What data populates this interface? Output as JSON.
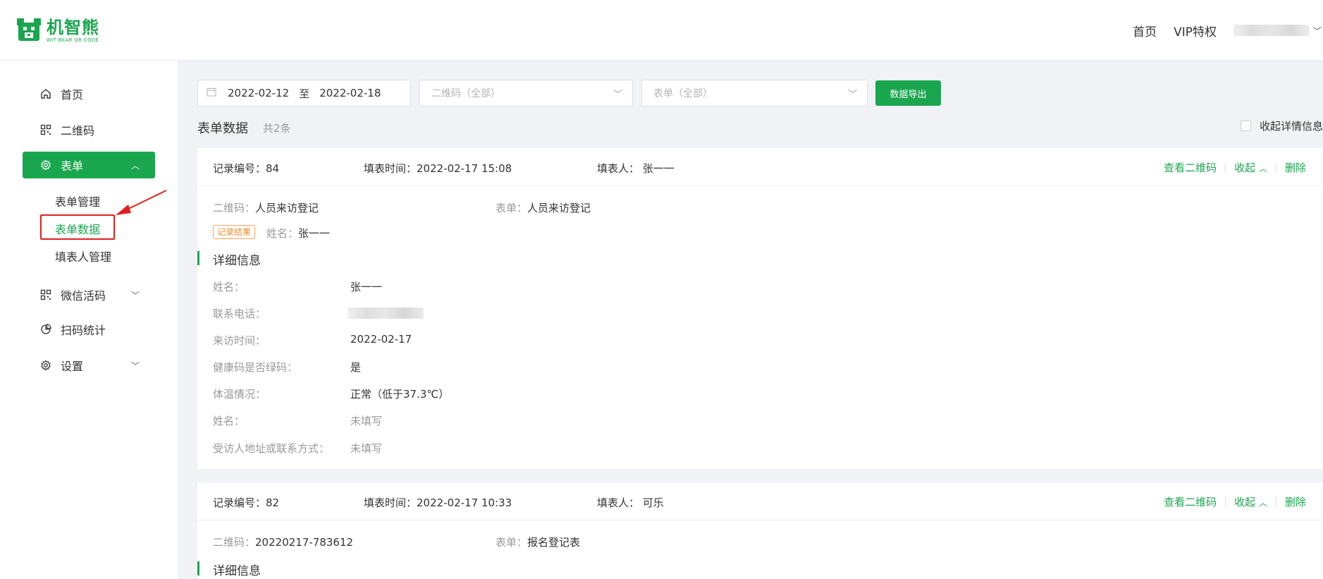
{
  "brand": {
    "name": "机智熊",
    "sub": "WIT BEAR QR CODE",
    "color": "#1aa64f"
  },
  "topnav": {
    "home": "首页",
    "vip": "VIP特权"
  },
  "sidebar": {
    "items": [
      {
        "label": "首页",
        "icon": "home-icon"
      },
      {
        "label": "二维码",
        "icon": "qrcode-icon"
      },
      {
        "label": "表单",
        "icon": "gear-icon"
      },
      {
        "label": "微信活码",
        "icon": "qrcode-icon"
      },
      {
        "label": "扫码统计",
        "icon": "pie-chart-icon"
      },
      {
        "label": "设置",
        "icon": "gear-icon"
      }
    ],
    "form_sub": [
      "表单管理",
      "表单数据",
      "填表人管理"
    ]
  },
  "filters": {
    "date_start": "2022-02-12",
    "date_sep": "至",
    "date_end": "2022-02-18",
    "qrcode_placeholder": "二维码（全部）",
    "form_placeholder": "表单（全部）",
    "export_label": "数据导出"
  },
  "section": {
    "title": "表单数据",
    "count": "共2条",
    "collapse_label": "收起详情信息"
  },
  "records": [
    {
      "id_label": "记录编号：",
      "id": "84",
      "time_label": "填表时间：",
      "time": "2022-02-17 15:08",
      "filler_label": "填表人：",
      "filler": "张一一",
      "actions": {
        "view_qr": "查看二维码",
        "collapse": "收起",
        "delete": "删除"
      },
      "qrcode_label": "二维码：",
      "qrcode": "人员来访登记",
      "form_label": "表单：",
      "form": "人员来访登记",
      "result_tag": "记录结果",
      "result_label": "姓名：",
      "result_value": "张一一",
      "detail_title": "详细信息",
      "details": [
        {
          "label": "姓名：",
          "value": "张一一"
        },
        {
          "label": "联系电话：",
          "value": ""
        },
        {
          "label": "来访时间：",
          "value": "2022-02-17"
        },
        {
          "label": "健康码是否绿码：",
          "value": "是"
        },
        {
          "label": "体温情况：",
          "value": "正常（低于37.3℃）"
        },
        {
          "label": "姓名：",
          "value": "未填写"
        },
        {
          "label": "受访人地址或联系方式：",
          "value": "未填写"
        }
      ]
    },
    {
      "id_label": "记录编号：",
      "id": "82",
      "time_label": "填表时间：",
      "time": "2022-02-17 10:33",
      "filler_label": "填表人：",
      "filler": "可乐",
      "actions": {
        "view_qr": "查看二维码",
        "collapse": "收起",
        "delete": "删除"
      },
      "qrcode_label": "二维码：",
      "qrcode": "20220217-783612",
      "form_label": "表单：",
      "form": "报名登记表",
      "detail_title": "详细信息"
    }
  ]
}
